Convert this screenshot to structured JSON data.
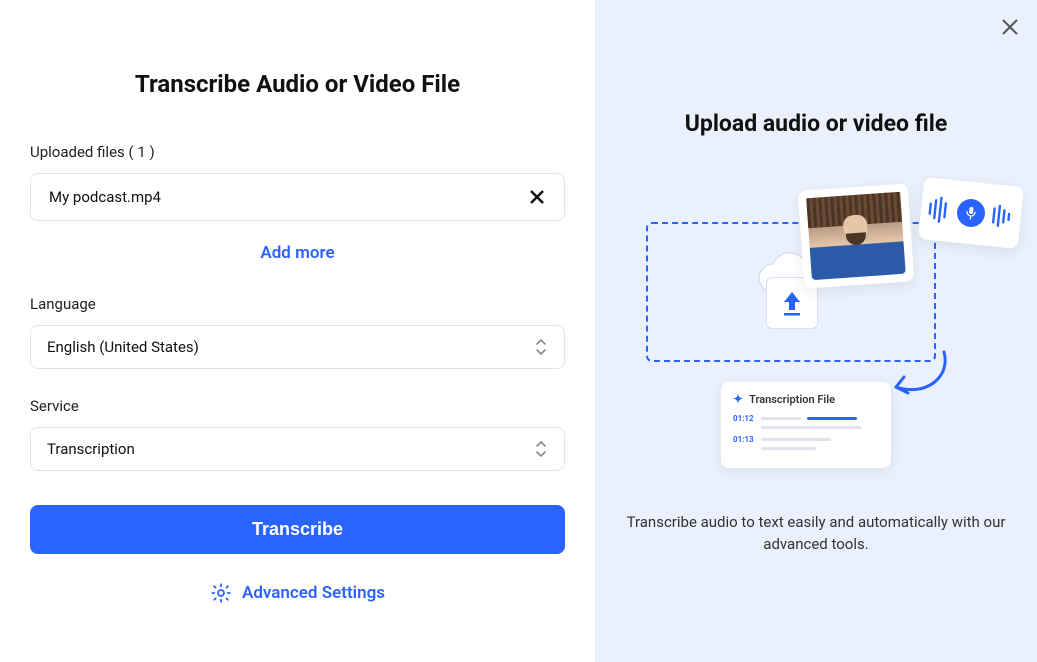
{
  "left": {
    "title": "Transcribe Audio or Video File",
    "uploaded_label": "Uploaded files ( 1 )",
    "file_name": "My podcast.mp4",
    "add_more": "Add more",
    "language_label": "Language",
    "language_value": "English (United States)",
    "service_label": "Service",
    "service_value": "Transcription",
    "transcribe_button": "Transcribe",
    "advanced_settings": "Advanced Settings"
  },
  "right": {
    "title": "Upload audio or video file",
    "subtitle": "Transcribe audio to text easily and automatically with our advanced tools.",
    "transcription_card_title": "Transcription File",
    "timestamps": [
      "01:12",
      "01:13"
    ]
  }
}
